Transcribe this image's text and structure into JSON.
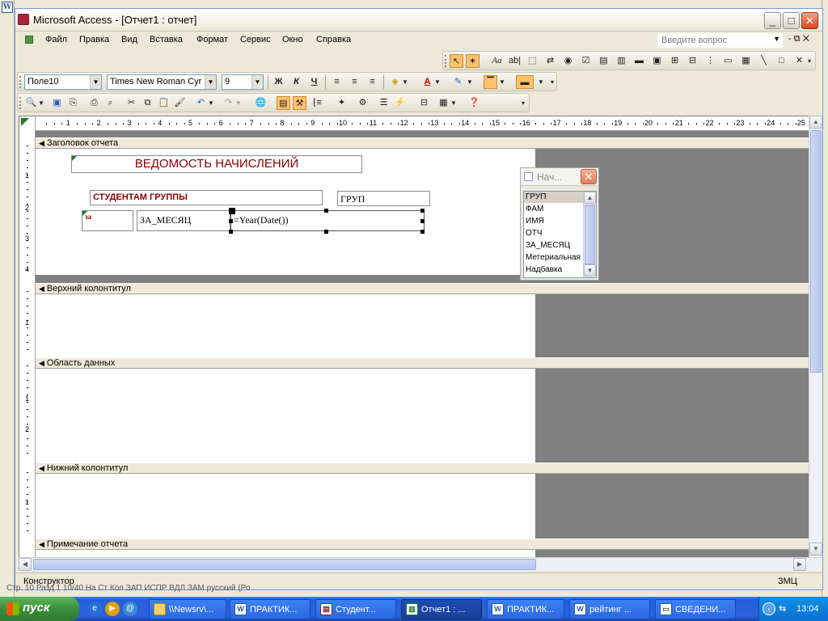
{
  "window": {
    "title": "Microsoft Access - [Отчет1 : отчет]",
    "minimize": "_",
    "maximize": "□",
    "close": "✕"
  },
  "menu": {
    "items": [
      "Файл",
      "Правка",
      "Вид",
      "Вставка",
      "Формат",
      "Сервис",
      "Окно",
      "Справка"
    ],
    "help_placeholder": "Введите вопрос",
    "mdi_controls": "-  ⧉  ✕"
  },
  "toolbar_format": {
    "object_combo": "Поле10",
    "font_combo": "Times New Roman Cyr",
    "size_combo": "9",
    "bold": "Ж",
    "italic": "К",
    "underline": "Ч"
  },
  "toolbox": {
    "label_tool": "Aa",
    "textbox_tool": "ab|"
  },
  "ruler": {
    "numbers": [
      "1",
      "2",
      "3",
      "4",
      "5",
      "6",
      "7",
      "8",
      "9",
      "10",
      "11",
      "12",
      "13",
      "14",
      "15",
      "16",
      "17",
      "18",
      "19",
      "20",
      "21",
      "22",
      "23",
      "24",
      "25"
    ],
    "vertical_numbers": [
      "1",
      "2",
      "3",
      "4",
      "1",
      "1",
      "2",
      "1"
    ]
  },
  "sections": {
    "report_header": "Заголовок отчета",
    "page_header": "Верхний колонтитул",
    "detail": "Область данных",
    "page_footer": "Нижний колонтитул",
    "report_footer": "Примечание отчета"
  },
  "controls": {
    "title": "ВЕДОМОСТЬ НАЧИСЛЕНИЙ",
    "group_label": "СТУДЕНТАМ ГРУППЫ",
    "group_field": "ГРУП",
    "month_label": "за",
    "month_field": "ЗА_МЕСЯЦ",
    "year_expr": "=Year(Date())"
  },
  "field_list": {
    "title": "Нач...",
    "fields": [
      "ГРУП",
      "ФАМ",
      "ИМЯ",
      "ОТЧ",
      "ЗА_МЕСЯЦ",
      "Метериальная",
      "Надбавка"
    ],
    "selected": "ГРУП"
  },
  "status": {
    "left": "Конструктор",
    "right": "ЗМЦ"
  },
  "word_status": "Стр. 10    Разд 1    10/40    На    Ст    Кол    ЗАП  ИСПР  ВДЛ  ЗАМ  русский (Ро",
  "taskbar": {
    "start": "пуск",
    "tasks": [
      "\\\\Newsrv\\...",
      "ПРАКТИК...",
      "Студент...",
      "Отчет1 : ...",
      "ПРАКТИК...",
      "рейтинг ...",
      "СВЕДЕНИ..."
    ],
    "active_index": 3,
    "clock": "13:04"
  },
  "colors": {
    "title_text": "#8b0000",
    "selected_tool": "#ffc26b",
    "grid_gray": "#808080"
  }
}
